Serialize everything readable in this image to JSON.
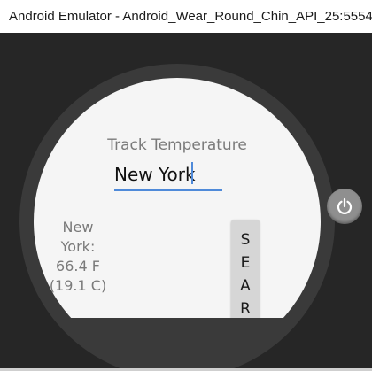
{
  "window": {
    "title": "Android Emulator - Android_Wear_Round_Chin_API_25:5554"
  },
  "app": {
    "title": "Track Temperature",
    "city_input_value": "New York",
    "result_lines": [
      "New",
      "York:",
      "66.4 F",
      "(19.1 C)"
    ],
    "search_button_label": "SEARCH"
  },
  "controls": {
    "power_icon": "power-icon"
  },
  "colors": {
    "accent": "#4f8ad9",
    "bezel": "#262626",
    "screen": "#f5f5f5"
  }
}
